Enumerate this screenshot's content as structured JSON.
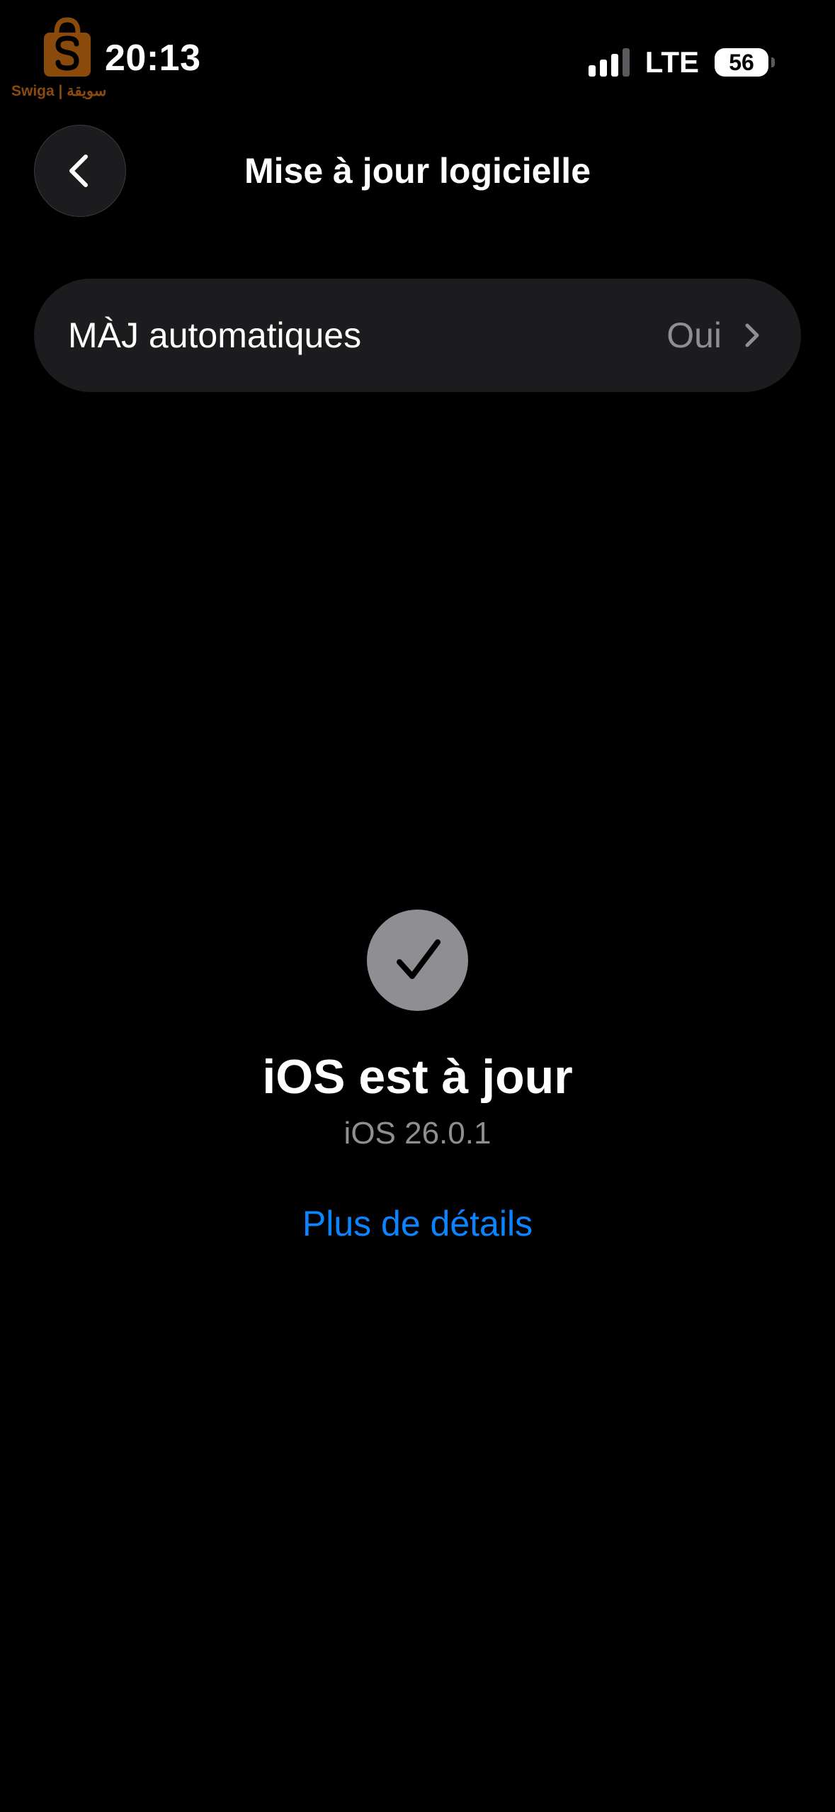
{
  "watermark": {
    "name_latin": "Swiga",
    "separator": "|",
    "name_arabic": "سويقة"
  },
  "status_bar": {
    "time": "20:13",
    "network": "LTE",
    "battery_level": "56",
    "signal_bars_active": 3,
    "signal_bars_total": 4
  },
  "nav": {
    "back_icon": "chevron-left-icon",
    "title": "Mise à jour logicielle"
  },
  "auto_updates": {
    "label": "MÀJ automatiques",
    "value": "Oui",
    "icon": "chevron-right-icon"
  },
  "update_status": {
    "icon": "checkmark-icon",
    "heading": "iOS est à jour",
    "version": "iOS 26.0.1",
    "details_link": "Plus de détails"
  },
  "colors": {
    "background": "#000000",
    "cell": "#1c1c1e",
    "secondary_text": "#8e8e93",
    "link": "#0a84ff",
    "watermark": "#8a4a0c"
  }
}
